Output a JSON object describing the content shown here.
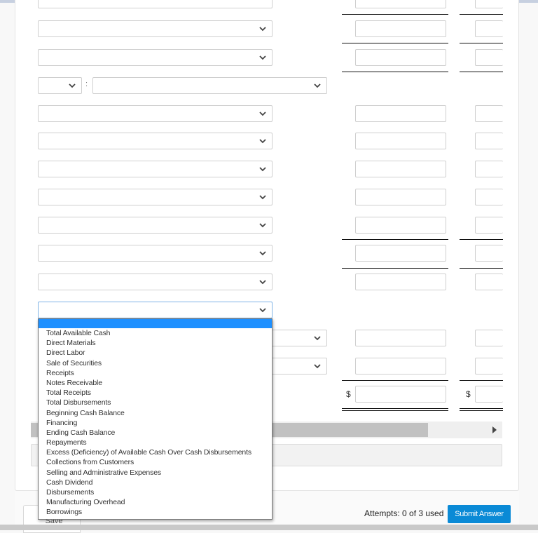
{
  "form": {
    "rows": [
      {
        "type": "select-row",
        "label_value": "",
        "amount_col1": "",
        "amount_col2": ""
      },
      {
        "type": "select-row",
        "label_value": "",
        "amount_col1": "",
        "amount_col2": ""
      },
      {
        "type": "select-row",
        "label_value": "",
        "amount_col1": "",
        "amount_col2": ""
      },
      {
        "type": "split-select-row",
        "prefix_value": "",
        "separator": ":",
        "label_value": ""
      },
      {
        "type": "select-row",
        "label_value": "",
        "amount_col1": "",
        "amount_col2": ""
      },
      {
        "type": "select-row",
        "label_value": "",
        "amount_col1": "",
        "amount_col2": ""
      },
      {
        "type": "select-row",
        "label_value": "",
        "amount_col1": "",
        "amount_col2": ""
      },
      {
        "type": "select-row",
        "label_value": "",
        "amount_col1": "",
        "amount_col2": ""
      },
      {
        "type": "select-row",
        "label_value": "",
        "amount_col1": "",
        "amount_col2": ""
      },
      {
        "type": "select-row",
        "label_value": "",
        "amount_col1": "",
        "amount_col2": ""
      },
      {
        "type": "select-row",
        "label_value": "",
        "amount_col1": "",
        "amount_col2": ""
      },
      {
        "type": "select-row-open",
        "label_value": ""
      },
      {
        "type": "indented-select-row",
        "label_value": "",
        "amount_col1": "",
        "amount_col2": ""
      },
      {
        "type": "indented-select-row",
        "label_value": "",
        "amount_col1": "",
        "amount_col2": ""
      },
      {
        "type": "total-row",
        "currency_symbol": "$",
        "amount_col1": "",
        "amount_col2": ""
      }
    ],
    "currency_symbol": "$"
  },
  "dropdown": {
    "options": [
      "",
      "Total Available Cash",
      "Direct Materials",
      "Direct Labor",
      "Sale of Securities",
      "Receipts",
      "Notes Receivable",
      "Total Receipts",
      "Total Disbursements",
      "Beginning Cash Balance",
      "Financing",
      "Ending Cash Balance",
      "Repayments",
      "Excess (Deficiency) of Available Cash Over Cash Disbursements",
      "Collections from Customers",
      "Selling and Administrative Expenses",
      "Cash Dividend",
      "Disbursements",
      "Manufacturing Overhead",
      "Borrowings"
    ],
    "highlighted_index": 0
  },
  "footer": {
    "save_label": "Save",
    "attempts_text": "Attempts: 0 of 3 used",
    "submit_label": "Submit Answer"
  },
  "colors": {
    "accent": "#0a8ad6",
    "highlight": "#1e90ff"
  }
}
